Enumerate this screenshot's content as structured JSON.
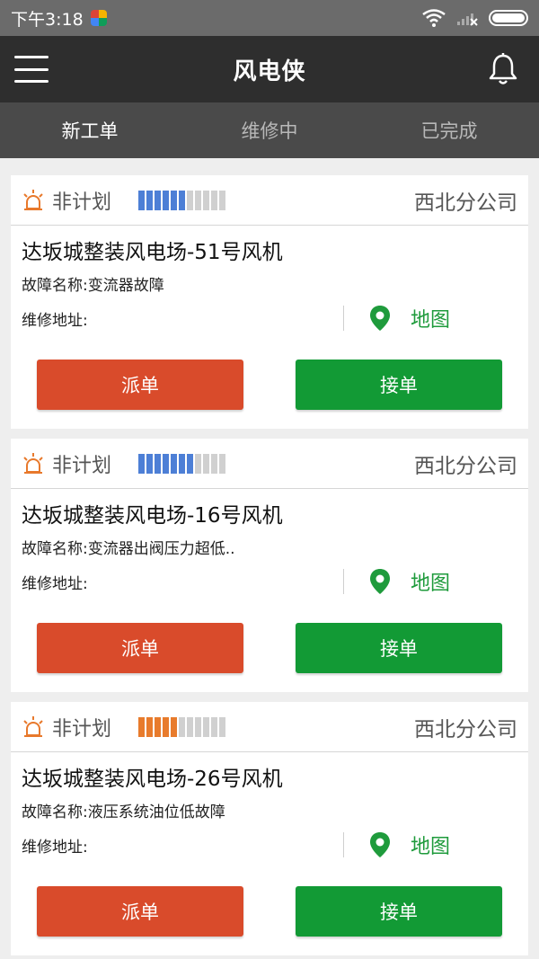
{
  "status_bar": {
    "time": "下午3:18"
  },
  "header": {
    "title": "风电侠"
  },
  "tabs": [
    {
      "label": "新工单",
      "active": true
    },
    {
      "label": "维修中",
      "active": false
    },
    {
      "label": "已完成",
      "active": false
    }
  ],
  "cards": [
    {
      "plan_type": "非计划",
      "progress_filled": 6,
      "progress_total": 11,
      "progress_color": "#4d7fd6",
      "company": "西北分公司",
      "turbine": "达坂城整装风电场-51号风机",
      "fault": "故障名称:变流器故障",
      "address_label": "维修地址:",
      "map_label": "地图",
      "dispatch_label": "派单",
      "accept_label": "接单"
    },
    {
      "plan_type": "非计划",
      "progress_filled": 7,
      "progress_total": 11,
      "progress_color": "#4d7fd6",
      "company": "西北分公司",
      "turbine": "达坂城整装风电场-16号风机",
      "fault": "故障名称:变流器出阀压力超低..",
      "address_label": "维修地址:",
      "map_label": "地图",
      "dispatch_label": "派单",
      "accept_label": "接单"
    },
    {
      "plan_type": "非计划",
      "progress_filled": 5,
      "progress_total": 11,
      "progress_color": "#e87b2c",
      "company": "西北分公司",
      "turbine": "达坂城整装风电场-26号风机",
      "fault": "故障名称:液压系统油位低故障",
      "address_label": "维修地址:",
      "map_label": "地图",
      "dispatch_label": "派单",
      "accept_label": "接单"
    }
  ],
  "colors": {
    "accent_green": "#129a35",
    "dispatch_red": "#d94b2b",
    "header_bg": "#2e2e2e"
  }
}
